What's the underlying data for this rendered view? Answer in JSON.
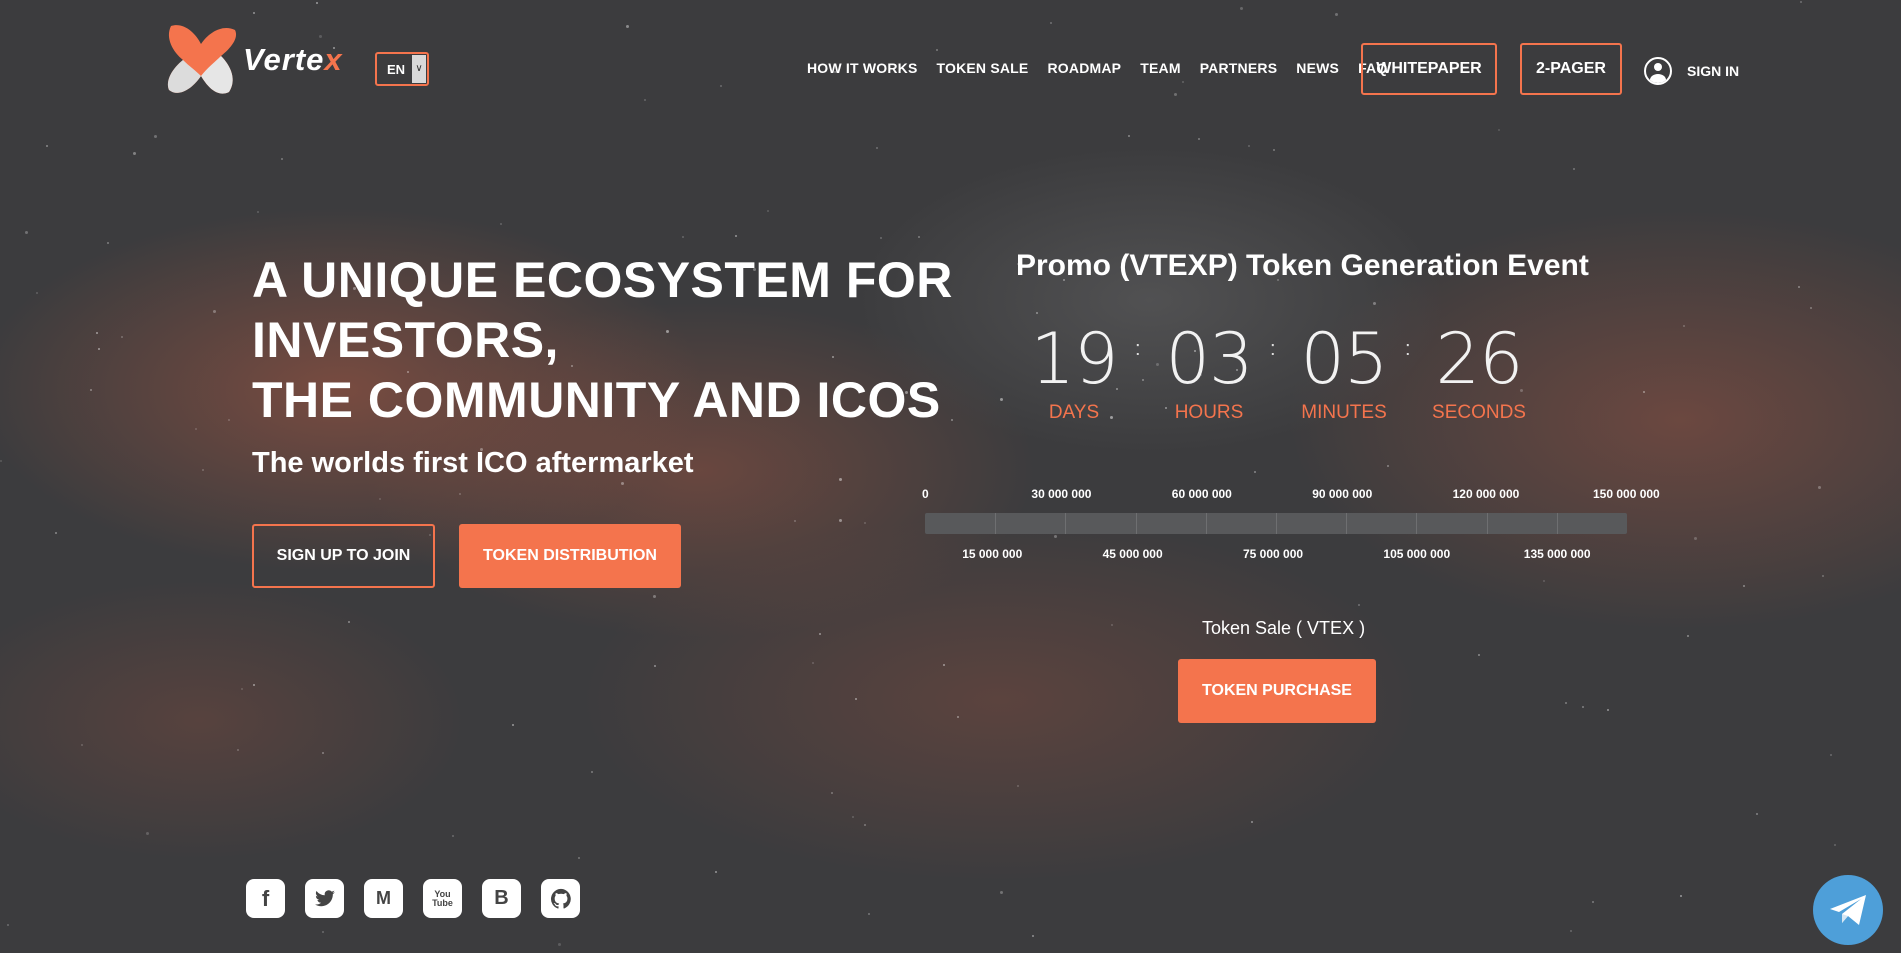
{
  "brand": {
    "name_main": "Verte",
    "name_x": "x",
    "accent_color": "#f4744d",
    "logo_icon": "vertex-logo-icon"
  },
  "language": {
    "selected": "EN"
  },
  "nav": {
    "items": [
      "HOW IT WORKS",
      "TOKEN SALE",
      "ROADMAP",
      "TEAM",
      "PARTNERS",
      "NEWS",
      "FAQ"
    ],
    "whitepaper": "WHITEPAPER",
    "two_pager": "2-PAGER",
    "sign_in": "SIGN IN"
  },
  "hero": {
    "title_lines": [
      "A UNIQUE ECOSYSTEM FOR",
      "INVESTORS,",
      "THE COMMUNITY AND ICOS"
    ],
    "subtitle": "The worlds first ICO aftermarket",
    "signup_button": "SIGN UP TO JOIN",
    "distribution_button": "TOKEN DISTRIBUTION"
  },
  "countdown": {
    "title": "Promo (VTEXP) Token Generation Event",
    "days": "19",
    "hours": "03",
    "minutes": "05",
    "seconds": "26",
    "days_label": "DAYS",
    "hours_label": "HOURS",
    "minutes_label": "MINUTES",
    "seconds_label": "SECONDS",
    "separator": ":"
  },
  "progress": {
    "top_labels": [
      "0",
      "30 000 000",
      "60 000 000",
      "90 000 000",
      "120 000 000",
      "150 000 000"
    ],
    "bottom_labels": [
      "15 000 000",
      "45 000 000",
      "75 000 000",
      "105 000 000",
      "135 000 000"
    ],
    "filled_fraction": 0
  },
  "sale": {
    "label": "Token Sale ( VTEX )",
    "purchase_button": "TOKEN PURCHASE"
  },
  "social": {
    "icons": [
      "facebook-icon",
      "twitter-icon",
      "medium-icon",
      "youtube-icon",
      "bitcointalk-icon",
      "github-icon"
    ],
    "glyphs": [
      "f",
      "",
      "M",
      "You\nTube",
      "B",
      ""
    ]
  },
  "telegram": {
    "icon": "telegram-icon"
  }
}
